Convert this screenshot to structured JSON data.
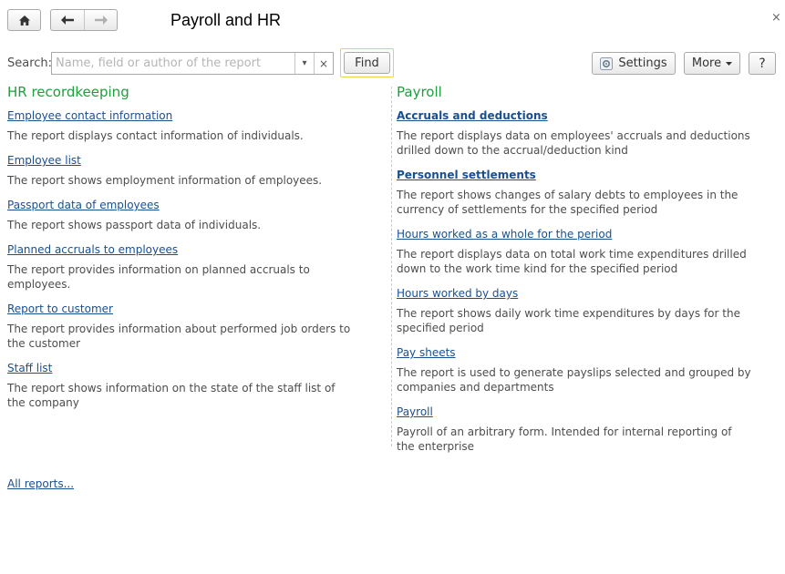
{
  "header": {
    "title": "Payroll and HR",
    "close": "×"
  },
  "search": {
    "label": "Search:",
    "placeholder": "Name, field or author of the report",
    "value": "",
    "dropdown_glyph": "▾",
    "clear_glyph": "×",
    "find_label": "Find"
  },
  "toolbar": {
    "settings_label": "Settings",
    "more_label": "More",
    "help_label": "?"
  },
  "left_group": {
    "title": "HR recordkeeping",
    "reports": [
      {
        "name": "Employee contact information",
        "desc": "The report displays contact information of individuals."
      },
      {
        "name": "Employee list",
        "desc": "The report shows employment information of employees."
      },
      {
        "name": "Passport data of employees",
        "desc": "The report shows passport data of individuals."
      },
      {
        "name": "Planned accruals to employees",
        "desc": "The report provides information on planned accruals to employees."
      },
      {
        "name": "Report to customer",
        "desc": "The report provides information about performed job orders to the customer"
      },
      {
        "name": "Staff list",
        "desc": "The report shows information on the state of the staff list of the company"
      }
    ]
  },
  "right_group": {
    "title": "Payroll",
    "reports": [
      {
        "name": "Accruals and deductions",
        "desc": "The report displays data on employees' accruals and deductions drilled down to the accrual/deduction kind"
      },
      {
        "name": "Personnel settlements",
        "desc": "The report shows changes of salary debts to employees in the currency of settlements for the specified period"
      },
      {
        "name": "Hours worked as a whole for the period",
        "desc": "The report displays data on total work time expenditures drilled down to the work time kind for the specified period"
      },
      {
        "name": "Hours worked by days",
        "desc": "The report shows daily work time expenditures by days for the specified period"
      },
      {
        "name": "Pay sheets",
        "desc": "The report is used to generate payslips selected and grouped by companies and departments"
      },
      {
        "name": "Payroll",
        "desc": "Payroll of an arbitrary form. Intended for internal reporting of the enterprise"
      }
    ]
  },
  "footer": {
    "all_reports_label": "All reports..."
  },
  "colors": {
    "group_title": "#1f9e3e",
    "link": "#1a4f8f",
    "text": "#4d4d4d",
    "find_highlight": "#e8d44a"
  },
  "icons": [
    "home-icon",
    "back-arrow-icon",
    "forward-arrow-icon",
    "close-icon",
    "settings-icon",
    "chevron-down-icon",
    "help-icon"
  ]
}
